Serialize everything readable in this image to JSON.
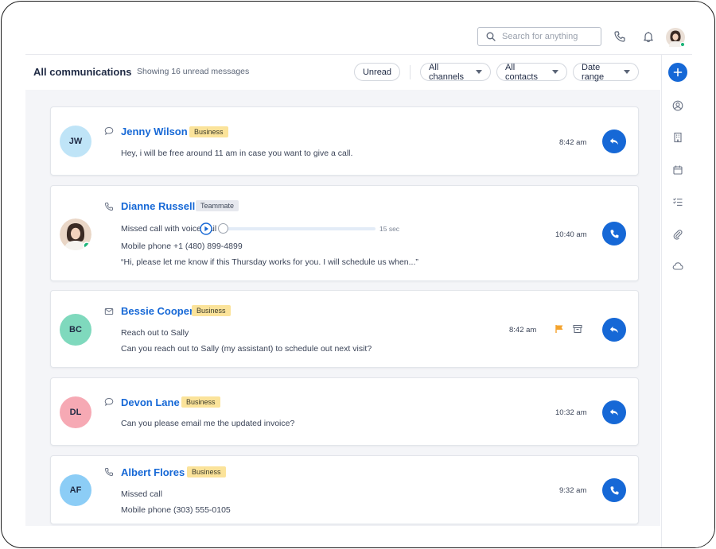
{
  "search": {
    "placeholder": "Search for anything"
  },
  "header": {
    "title": "All communications",
    "subtitle": "Showing 16 unread messages"
  },
  "filters": {
    "unread": "Unread",
    "channels": "All channels",
    "contacts": "All contacts",
    "date": "Date range"
  },
  "colors": {
    "accent": "#1668d6",
    "business": "#fbe39a",
    "teammate": "#e6e8ee",
    "online": "#1fb57a",
    "flag": "#f4a32d"
  },
  "messages": [
    {
      "initials": "JW",
      "avatar_color": "#bfe4f7",
      "channel_icon": "chat-bubble-icon",
      "name": "Jenny Wilson",
      "tag": "Business",
      "text": "Hey, i will be free around 11 am in case you want to give a call.",
      "time": "8:42 am",
      "action": "reply-icon"
    },
    {
      "initials": "",
      "avatar_color": "#e9d6c6",
      "channel_icon": "phone-icon",
      "name": "Dianne Russell",
      "tag": "Teammate",
      "text": "Missed call with voicemail",
      "voicemail_length": "15 sec",
      "voicemail_progress": 0,
      "phone": "Mobile phone +1 (480) 899-4899",
      "transcript": "“Hi, please let me know if this Thursday works for you. I will schedule us when...”",
      "time": "10:40 am",
      "action": "phone-icon"
    },
    {
      "initials": "BC",
      "avatar_color": "#7fd9bd",
      "channel_icon": "envelope-icon",
      "name": "Bessie Cooper",
      "tag": "Business",
      "subject": "Reach out to Sally",
      "text": "Can you reach out to Sally (my assistant) to schedule out next visit?",
      "time": "8:42 am",
      "action": "reply-icon"
    },
    {
      "initials": "DL",
      "avatar_color": "#f6a9b4",
      "channel_icon": "chat-bubble-icon",
      "name": "Devon Lane",
      "tag": "Business",
      "text": "Can you please email me the updated invoice?",
      "time": "10:32 am",
      "action": "reply-icon"
    },
    {
      "initials": "AF",
      "avatar_color": "#8ccdf6",
      "channel_icon": "phone-icon",
      "name": "Albert Flores",
      "tag": "Business",
      "text": "Missed call",
      "phone": "Mobile phone (303) 555-0105",
      "time": "9:32 am",
      "action": "phone-icon"
    }
  ],
  "sidebar_icons": [
    "user-circle-icon",
    "building-icon",
    "calendar-icon",
    "checklist-icon",
    "paperclip-icon",
    "cloud-icon"
  ]
}
